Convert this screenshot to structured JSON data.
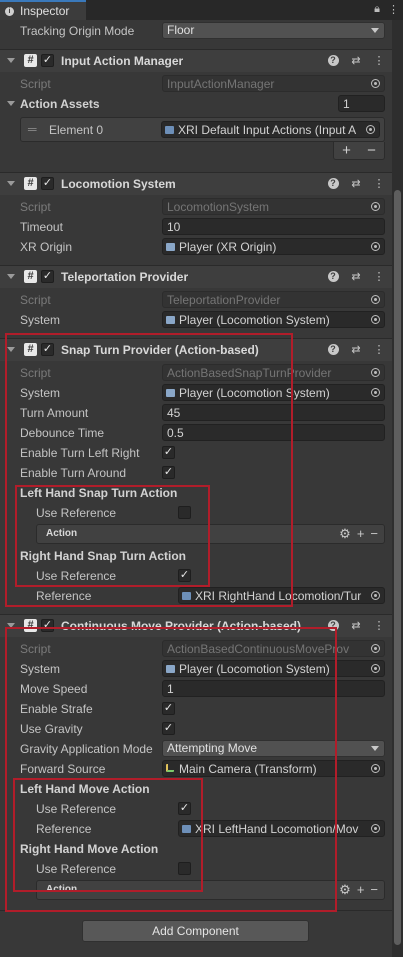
{
  "tab": {
    "title": "Inspector"
  },
  "top_row": {
    "label": "Tracking Origin Mode",
    "value": "Floor"
  },
  "input_action_manager": {
    "title": "Input Action Manager",
    "script_label": "Script",
    "script_value": "InputActionManager",
    "assets_label": "Action Assets",
    "assets_count": "1",
    "element_label": "Element 0",
    "element_value": "XRI Default Input Actions (Input A"
  },
  "locomotion_system": {
    "title": "Locomotion System",
    "script_label": "Script",
    "script_value": "LocomotionSystem",
    "timeout_label": "Timeout",
    "timeout_value": "10",
    "origin_label": "XR Origin",
    "origin_value": "Player (XR Origin)"
  },
  "teleportation_provider": {
    "title": "Teleportation Provider",
    "script_label": "Script",
    "script_value": "TeleportationProvider",
    "system_label": "System",
    "system_value": "Player (Locomotion System)"
  },
  "snap_turn": {
    "title": "Snap Turn Provider (Action-based)",
    "script_label": "Script",
    "script_value": "ActionBasedSnapTurnProvider",
    "system_label": "System",
    "system_value": "Player (Locomotion System)",
    "turn_amount_label": "Turn Amount",
    "turn_amount_value": "45",
    "debounce_label": "Debounce Time",
    "debounce_value": "0.5",
    "enable_lr_label": "Enable Turn Left Right",
    "enable_around_label": "Enable Turn Around",
    "left_action_label": "Left Hand Snap Turn Action",
    "left_use_ref_label": "Use Reference",
    "left_action_box": "Action",
    "right_action_label": "Right Hand Snap Turn Action",
    "right_use_ref_label": "Use Reference",
    "right_ref_label": "Reference",
    "right_ref_value": "XRI RightHand Locomotion/Tur"
  },
  "continuous_move": {
    "title": "Continuous Move Provider (Action-based)",
    "script_label": "Script",
    "script_value": "ActionBasedContinuousMoveProv",
    "system_label": "System",
    "system_value": "Player (Locomotion System)",
    "move_speed_label": "Move Speed",
    "move_speed_value": "1",
    "strafe_label": "Enable Strafe",
    "gravity_label": "Use Gravity",
    "gravity_mode_label": "Gravity Application Mode",
    "gravity_mode_value": "Attempting Move",
    "forward_label": "Forward Source",
    "forward_value": "Main Camera (Transform)",
    "left_action_label": "Left Hand Move Action",
    "left_use_ref_label": "Use Reference",
    "left_ref_label": "Reference",
    "left_ref_value": "XRI LeftHand Locomotion/Mov",
    "right_action_label": "Right Hand Move Action",
    "right_use_ref_label": "Use Reference",
    "right_action_box": "Action"
  },
  "add_component": "Add Component",
  "colors": {
    "highlight": "#b11d2a",
    "background": "#383838"
  }
}
